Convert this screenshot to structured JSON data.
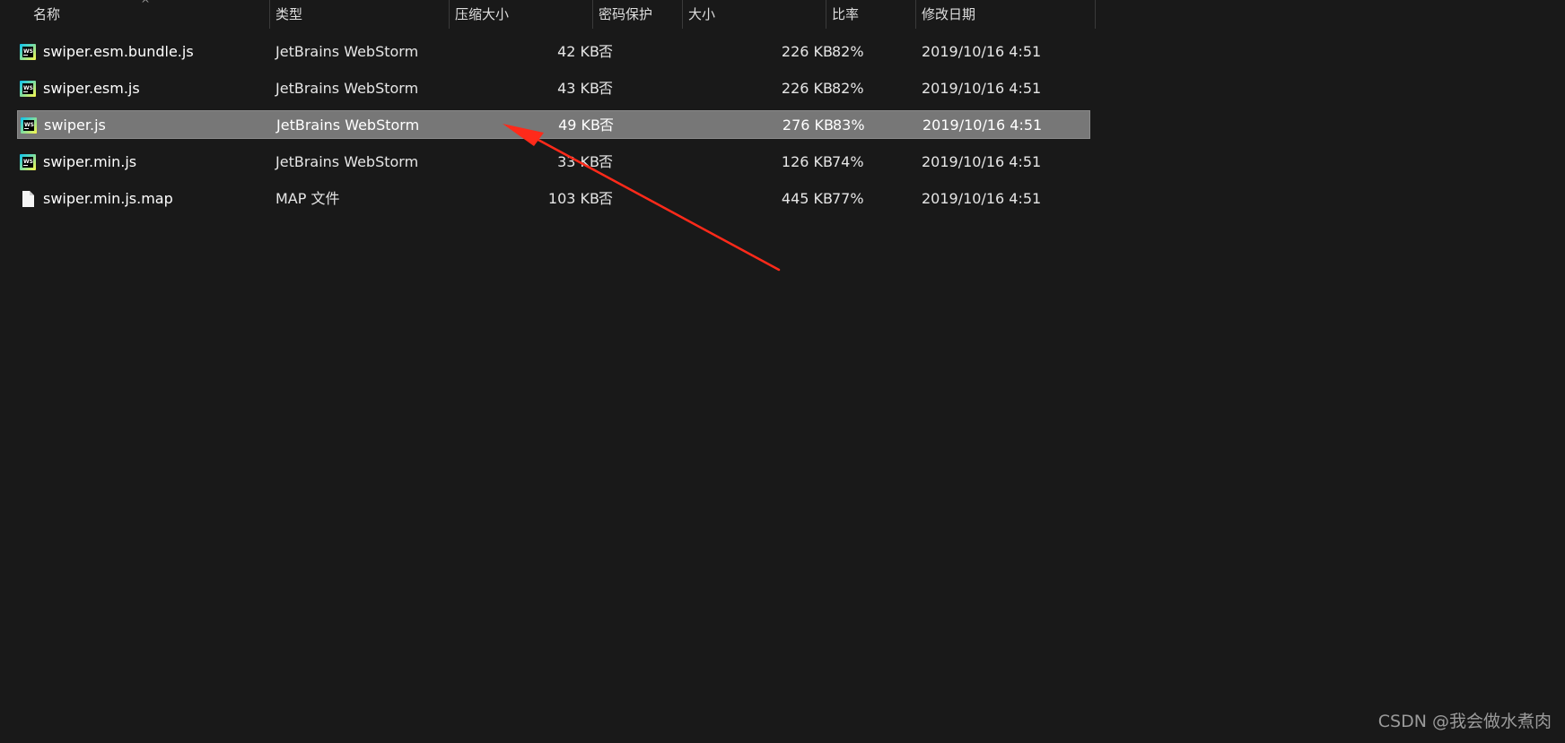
{
  "header": {
    "columns": [
      {
        "key": "name",
        "label": "名称"
      },
      {
        "key": "type",
        "label": "类型"
      },
      {
        "key": "csize",
        "label": "压缩大小"
      },
      {
        "key": "pwd",
        "label": "密码保护"
      },
      {
        "key": "size",
        "label": "大小"
      },
      {
        "key": "ratio",
        "label": "比率"
      },
      {
        "key": "date",
        "label": "修改日期"
      }
    ],
    "sort_indicator": "^"
  },
  "files": [
    {
      "name": "swiper.esm.bundle.js",
      "type": "JetBrains WebStorm",
      "csize": "42 KB",
      "pwd": "否",
      "size": "226 KB",
      "ratio": "82%",
      "date": "2019/10/16 4:51",
      "icon": "webstorm-icon",
      "selected": false
    },
    {
      "name": "swiper.esm.js",
      "type": "JetBrains WebStorm",
      "csize": "43 KB",
      "pwd": "否",
      "size": "226 KB",
      "ratio": "82%",
      "date": "2019/10/16 4:51",
      "icon": "webstorm-icon",
      "selected": false
    },
    {
      "name": "swiper.js",
      "type": "JetBrains WebStorm",
      "csize": "49 KB",
      "pwd": "否",
      "size": "276 KB",
      "ratio": "83%",
      "date": "2019/10/16 4:51",
      "icon": "webstorm-icon",
      "selected": true
    },
    {
      "name": "swiper.min.js",
      "type": "JetBrains WebStorm",
      "csize": "33 KB",
      "pwd": "否",
      "size": "126 KB",
      "ratio": "74%",
      "date": "2019/10/16 4:51",
      "icon": "webstorm-icon",
      "selected": false
    },
    {
      "name": "swiper.min.js.map",
      "type": "MAP 文件",
      "csize": "103 KB",
      "pwd": "否",
      "size": "445 KB",
      "ratio": "77%",
      "date": "2019/10/16 4:51",
      "icon": "blank-file-icon",
      "selected": false
    }
  ],
  "annotation": {
    "icon": "red-arrow-icon",
    "color": "#ff2a1a"
  },
  "watermark": "CSDN @我会做水煮肉",
  "colors": {
    "background": "#191919",
    "selected_row": "#777777"
  }
}
